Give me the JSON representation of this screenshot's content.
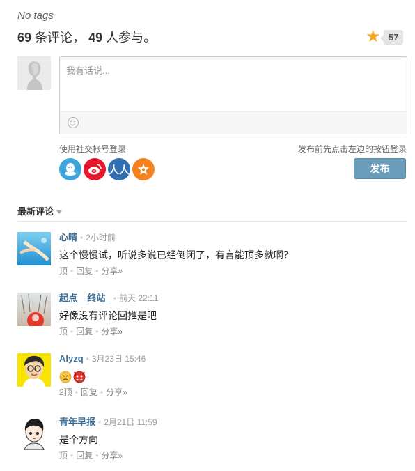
{
  "tags_text": "No tags",
  "summary": {
    "comment_count": "69",
    "comment_label": "条评论，",
    "participant_count": "49",
    "participant_label": "人参与。"
  },
  "favorite": {
    "icon": "star-icon",
    "count": "57",
    "color": "#f5a623"
  },
  "editor": {
    "placeholder": "我有话说..."
  },
  "login": {
    "hint": "使用社交帐号登录",
    "post_hint": "发布前先点击左边的按钮登录",
    "providers": [
      {
        "name": "qq-login",
        "color": "#3ea4dc"
      },
      {
        "name": "weibo-login",
        "color": "#e6162d"
      },
      {
        "name": "renren-login",
        "color": "#2f6fb2",
        "glyph": "人人"
      },
      {
        "name": "kaixin-login",
        "color": "#f58220"
      }
    ],
    "post_label": "发布"
  },
  "sort": {
    "label": "最新评论"
  },
  "comments": [
    {
      "user": "心晴",
      "time": "2小时前",
      "text": "这个慢慢试，听说多说已经倒闭了，有言能顶多就啊？",
      "up": "顶",
      "reply": "回复",
      "share": "分享»"
    },
    {
      "user": "起点__终站_",
      "time": "前天 22:11",
      "text": "好像没有评论回推是吧",
      "up": "顶",
      "reply": "回复",
      "share": "分享»"
    },
    {
      "user": "Alyzq",
      "time": "3月23日 15:46",
      "text": "",
      "up": "2顶",
      "reply": "回复",
      "share": "分享»"
    },
    {
      "user": "青年早报",
      "time": "2月21日 11:59",
      "text": "是个方向",
      "up": "顶",
      "reply": "回复",
      "share": "分享»"
    }
  ]
}
